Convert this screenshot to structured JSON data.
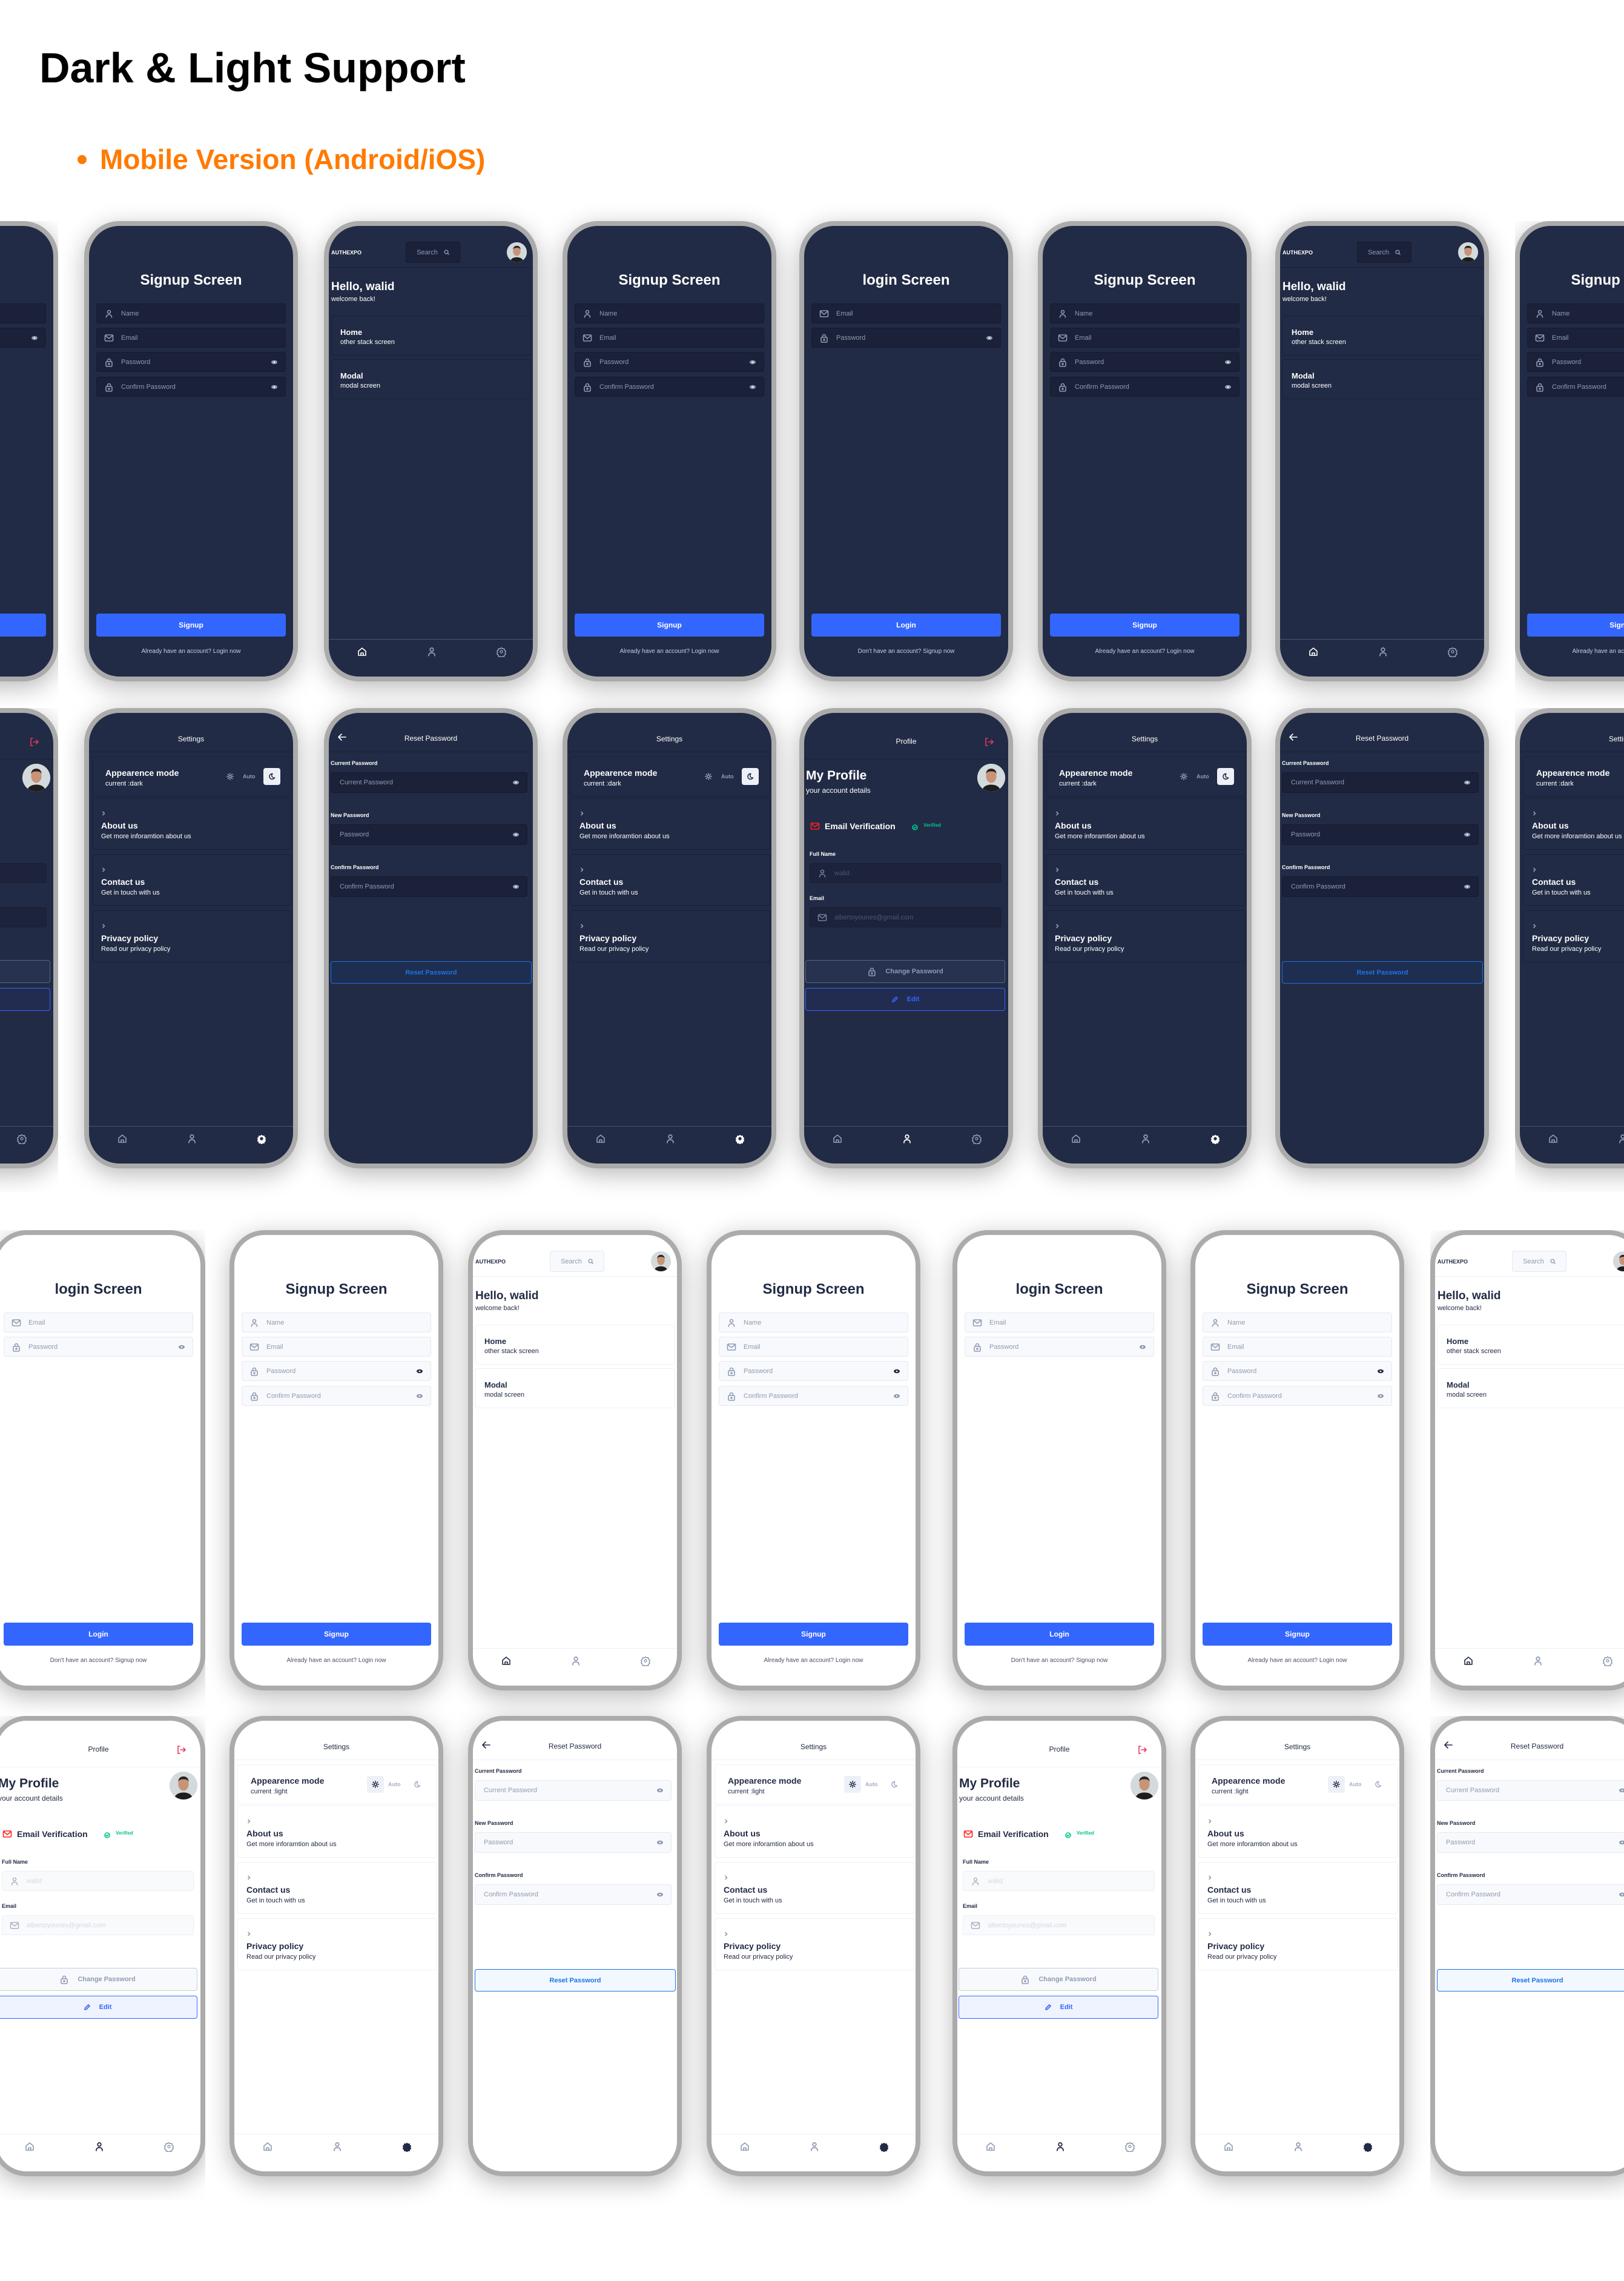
{
  "page": {
    "title": "Dark & Light Support",
    "subtitle": "Mobile Version (Android/iOS)"
  },
  "colors": {
    "accent": "#ff7a00",
    "primary": "#3366ff",
    "dark_bg": "#222b45",
    "light_bg": "#ffffff",
    "verified": "#00c48c",
    "logout": "#e8365d",
    "email_icon": "#ff1f1f"
  },
  "user": {
    "greeting": "Hello, walid",
    "welcome": "welcome back!",
    "name": "walid",
    "email": "albertoyounes@gmail.com"
  },
  "screens": {
    "login": {
      "title": "login Screen",
      "email_placeholder": "Email",
      "password_placeholder": "Password",
      "button": "Login",
      "footer": "Don't have an account? Signup now"
    },
    "signup": {
      "title": "Signup Screen",
      "name_placeholder": "Name",
      "email_placeholder": "Email",
      "password_placeholder": "Password",
      "confirm_placeholder": "Confirm Password",
      "button": "Signup",
      "footer": "Already have an account? Login now"
    },
    "home": {
      "brand": "AUTHEXPO",
      "search_placeholder": "Search",
      "cards": [
        {
          "title": "Home",
          "subtitle": "other stack screen"
        },
        {
          "title": "Modal",
          "subtitle": "modal screen"
        }
      ]
    },
    "settings": {
      "header": "Settings",
      "appearance_title": "Appearence mode",
      "appearance_current_dark": "current :dark",
      "appearance_current_light": "current :light",
      "auto_label": "Auto",
      "items": [
        {
          "title": "About us",
          "subtitle": "Get more inforamtion about us"
        },
        {
          "title": "Contact us",
          "subtitle": "Get in touch with us"
        },
        {
          "title": "Privacy policy",
          "subtitle": "Read our privacy policy"
        }
      ]
    },
    "reset": {
      "header": "Reset Password",
      "current_label": "Current Password",
      "current_placeholder": "Current Password",
      "new_label": "New Password",
      "new_placeholder": "Password",
      "confirm_label": "Confirm Password",
      "confirm_placeholder": "Confirm Password",
      "button": "Reset Password"
    },
    "profile": {
      "header": "Profile",
      "title": "My Profile",
      "subtitle": "your account details",
      "email_verification": "Email Verification",
      "verified": "Verified",
      "full_name_label": "Full Name",
      "email_label": "Email",
      "change_password": "Change Password",
      "edit": "Edit"
    }
  },
  "rows": [
    {
      "theme": "dark",
      "screens": [
        "login",
        "signup",
        "home",
        "signup",
        "login",
        "signup",
        "home",
        "signup"
      ]
    },
    {
      "theme": "dark",
      "screens": [
        "profile",
        "settings",
        "reset",
        "settings",
        "profile",
        "settings",
        "reset",
        "settings"
      ]
    },
    {
      "theme": "light",
      "screens": [
        "login",
        "signup",
        "home",
        "signup",
        "login",
        "signup",
        "home"
      ]
    },
    {
      "theme": "light",
      "screens": [
        "profile",
        "settings",
        "reset",
        "settings",
        "profile",
        "settings",
        "reset"
      ]
    }
  ]
}
